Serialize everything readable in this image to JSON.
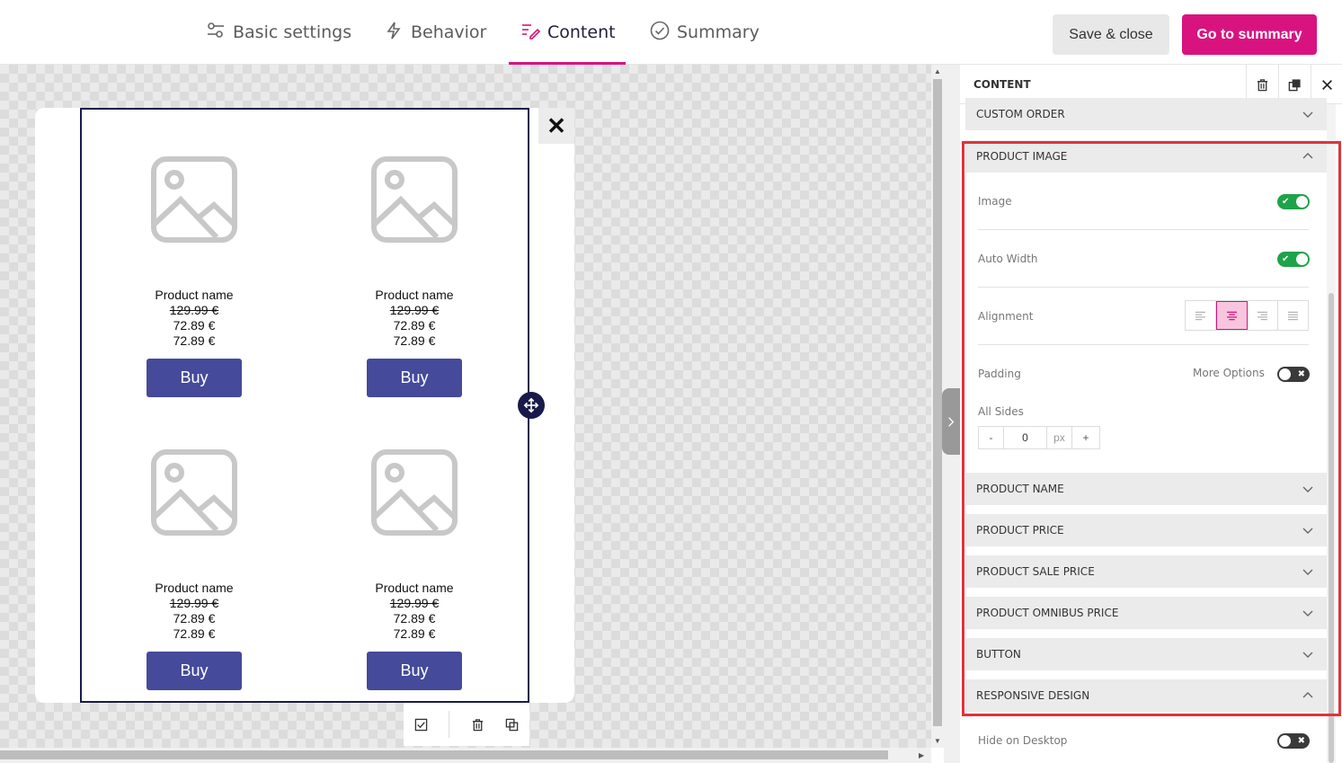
{
  "nav": {
    "tabs": [
      {
        "label": "Basic settings",
        "icon": "sliders-icon"
      },
      {
        "label": "Behavior",
        "icon": "lightning-icon"
      },
      {
        "label": "Content",
        "icon": "content-edit-icon",
        "active": true
      },
      {
        "label": "Summary",
        "icon": "check-circle-icon"
      }
    ],
    "save_close": "Save & close",
    "go_summary": "Go to summary"
  },
  "products": [
    {
      "name": "Product name",
      "old_price": "129.99 €",
      "price": "72.89 €",
      "omnibus": "72.89 €",
      "button": "Buy"
    },
    {
      "name": "Product name",
      "old_price": "129.99 €",
      "price": "72.89 €",
      "omnibus": "72.89 €",
      "button": "Buy"
    },
    {
      "name": "Product name",
      "old_price": "129.99 €",
      "price": "72.89 €",
      "omnibus": "72.89 €",
      "button": "Buy"
    },
    {
      "name": "Product name",
      "old_price": "129.99 €",
      "price": "72.89 €",
      "omnibus": "72.89 €",
      "button": "Buy"
    }
  ],
  "popup": {
    "close_symbol": "✕"
  },
  "panel": {
    "title": "CONTENT",
    "sections": {
      "custom_order": "CUSTOM ORDER",
      "product_image": "PRODUCT IMAGE",
      "product_name": "PRODUCT NAME",
      "product_price": "PRODUCT PRICE",
      "product_sale_price": "PRODUCT SALE PRICE",
      "product_omnibus_price": "PRODUCT OMNIBUS PRICE",
      "button": "BUTTON",
      "responsive_design": "RESPONSIVE DESIGN"
    },
    "image": {
      "image_label": "Image",
      "image_on": true,
      "auto_width_label": "Auto Width",
      "auto_width_on": true,
      "alignment_label": "Alignment",
      "alignment_selected": "center",
      "padding_label": "Padding",
      "more_options_label": "More Options",
      "more_options_on": false,
      "all_sides_label": "All Sides",
      "minus": "-",
      "plus": "+",
      "value": "0",
      "unit": "px"
    },
    "responsive": {
      "hide_desktop_label": "Hide on Desktop",
      "hide_desktop_on": false
    }
  },
  "colors": {
    "accent": "#d8137f",
    "buy_button": "#454a9a",
    "toggle_on": "#1ea34a",
    "highlight": "#e0333b"
  }
}
